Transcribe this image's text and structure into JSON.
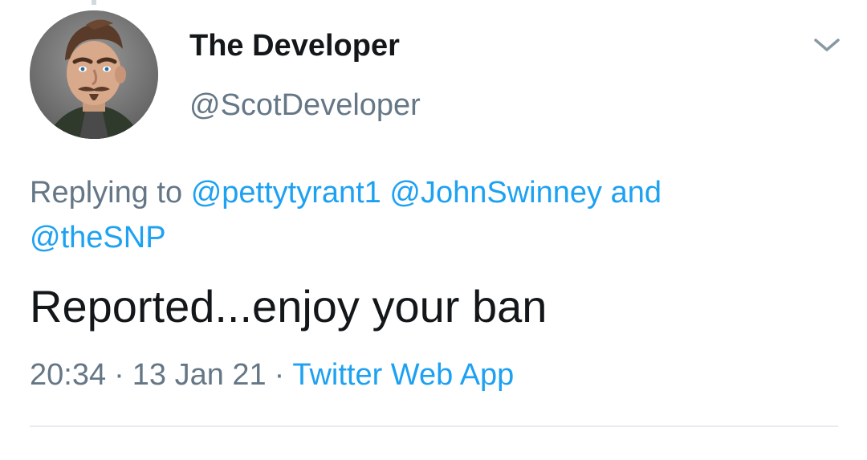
{
  "tweet": {
    "author": {
      "display_name": "The Developer",
      "handle": "@ScotDeveloper",
      "avatar_icon": "cartoon-man-avatar"
    },
    "menu_icon": "chevron-down-icon",
    "reply_context": {
      "prefix": "Replying to",
      "mentions": [
        "@pettytyrant1",
        "@JohnSwinney",
        "@theSNP"
      ],
      "conjunction": "and"
    },
    "text": "Reported...enjoy your ban",
    "time": "20:34",
    "date": "13 Jan 21",
    "separator": "·",
    "source": "Twitter Web App"
  },
  "colors": {
    "text_primary": "#14171a",
    "text_secondary": "#657786",
    "link": "#1da1f2",
    "divider": "#e6ecf0"
  }
}
